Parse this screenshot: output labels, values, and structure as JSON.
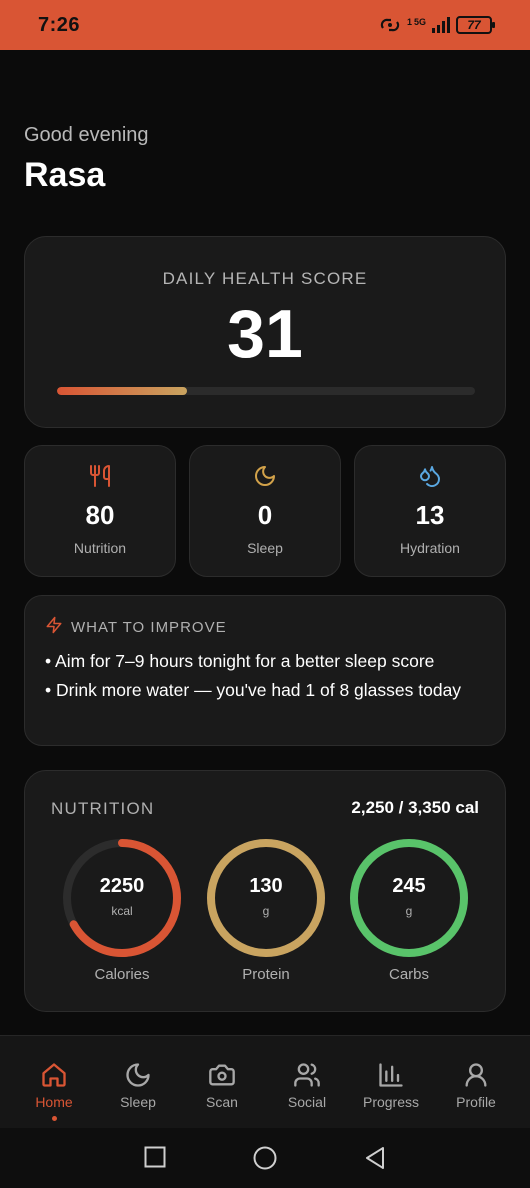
{
  "status_bar": {
    "time": "7:26",
    "network": "5G",
    "signal_sup": "1",
    "battery": "77"
  },
  "colors": {
    "accent": "#d95534",
    "protein": "#c9a460",
    "carbs": "#59c36a",
    "hydration": "#5aa7e0",
    "sleep": "#d2a24a"
  },
  "greeting": {
    "salutation": "Good evening",
    "name": "Rasa"
  },
  "health_score": {
    "title": "DAILY HEALTH SCORE",
    "value": "31",
    "progress_fraction": 0.31
  },
  "stats": [
    {
      "icon": "utensils-icon",
      "value": "80",
      "label": "Nutrition"
    },
    {
      "icon": "moon-icon",
      "value": "0",
      "label": "Sleep"
    },
    {
      "icon": "droplets-icon",
      "value": "13",
      "label": "Hydration"
    }
  ],
  "improve": {
    "icon": "lightning-icon",
    "title": "WHAT TO IMPROVE",
    "items": [
      "• Aim for 7–9 hours tonight for a better sleep score",
      "• Drink more water — you've had 1 of 8 glasses today"
    ]
  },
  "nutrition": {
    "title": "NUTRITION",
    "total": "2,250 / 3,350 cal",
    "rings": [
      {
        "value": "2250",
        "unit": "kcal",
        "label": "Calories",
        "fraction": 0.67
      },
      {
        "value": "130",
        "unit": "g",
        "label": "Protein",
        "fraction": 1.0
      },
      {
        "value": "245",
        "unit": "g",
        "label": "Carbs",
        "fraction": 1.0
      }
    ]
  },
  "tabs": [
    {
      "icon": "home-icon",
      "label": "Home",
      "active": true
    },
    {
      "icon": "moon-icon",
      "label": "Sleep",
      "active": false
    },
    {
      "icon": "camera-icon",
      "label": "Scan",
      "active": false
    },
    {
      "icon": "users-icon",
      "label": "Social",
      "active": false
    },
    {
      "icon": "bar-chart-icon",
      "label": "Progress",
      "active": false
    },
    {
      "icon": "user-icon",
      "label": "Profile",
      "active": false
    }
  ],
  "system_nav": {
    "recent": "square-icon",
    "home": "circle-icon",
    "back": "triangle-back-icon"
  }
}
